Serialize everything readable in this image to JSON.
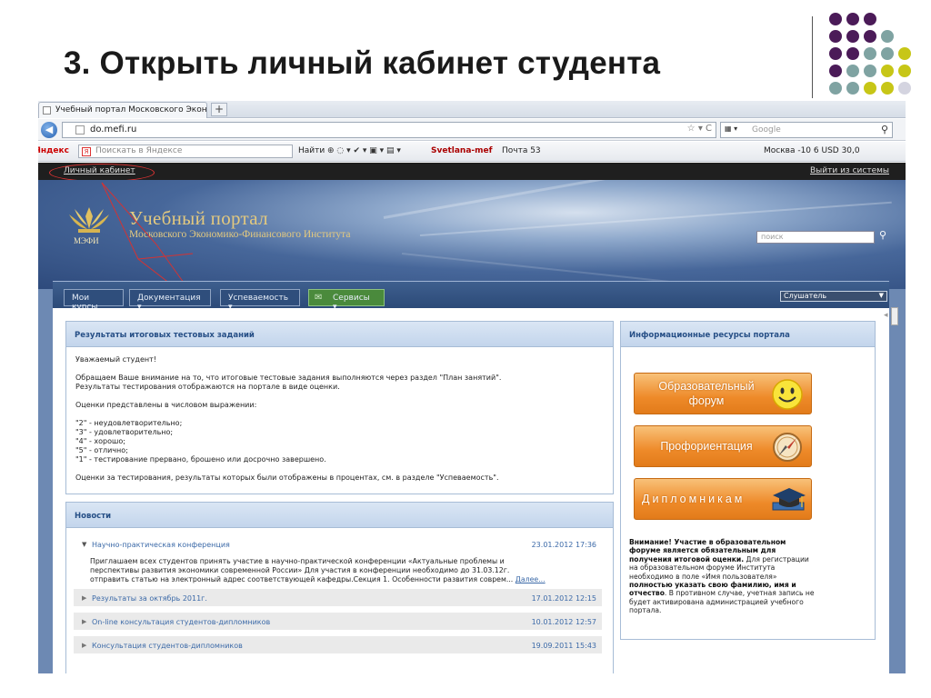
{
  "slide": {
    "title": "3. Открыть личный кабинет студента"
  },
  "browser": {
    "tab_title": "Учебный портал Московского Экон...",
    "new_tab": "+",
    "url": "do.mefi.ru",
    "search_placeholder": "Google",
    "yandex": {
      "logo": "Яндекс",
      "search_placeholder": "Поискать в Яндексе",
      "find_label": "Найти",
      "user": "Svetlana-mef",
      "mail": "Почта 53",
      "weather": "Москва -10 6 USD 30,0"
    }
  },
  "portal": {
    "top_links": {
      "cabinet": "Личный кабинет",
      "logout": "Выйти из системы"
    },
    "header": {
      "logo_abbr": "МЭФИ",
      "title": "Учебный портал",
      "subtitle": "Московского Экономико-Финансового Института",
      "search_placeholder": "поиск"
    },
    "menu": [
      {
        "label": "Мои курсы"
      },
      {
        "label": "Документация ▾"
      },
      {
        "label": "Успеваемость ▾"
      },
      {
        "label": "Сервисы ▾"
      }
    ],
    "role": "Слушатель",
    "results_panel": {
      "title": "Результаты итоговых тестовых заданий",
      "greeting": "Уважаемый студент!",
      "p1_line1": "Обращаем Ваше внимание на то, что итоговые тестовые задания выполняются через раздел \"План занятий\".",
      "p1_line2": "Результаты тестирования отображаются на портале в виде оценки.",
      "p2": "Оценки представлены в числовом выражении:",
      "grades": [
        "\"2\" - неудовлетворительно;",
        "\"3\" - удовлетворительно;",
        "\"4\" - хорошо;",
        "\"5\" - отлично;",
        "\"1\" -  тестирование прервано, брошено или досрочно завершено."
      ],
      "p3": "Оценки за тестирования, результаты которых были отображены в процентах, см. в разделе \"Успеваемость\"."
    },
    "news": {
      "title": "Новости",
      "open_item": {
        "title": "Научно-практическая конференция",
        "date": "23.01.2012 17:36",
        "line1": "Приглашаем всех студентов принять участие в научно-практической конференции «Актуальные проблемы и",
        "line2": "перспективы развития экономики современной России» Для участия в конференции необходимо до 31.03.12г.",
        "line3": "отправить статью на электронный адрес соответствующей кафедры.Секция 1. Особенности развития соврем...",
        "more": "Далее..."
      },
      "items": [
        {
          "title": "Результаты за октябрь 2011г.",
          "date": "17.01.2012 12:15"
        },
        {
          "title": "On-line консультация студентов-дипломников",
          "date": "10.01.2012 12:57"
        },
        {
          "title": "Консультация студентов-дипломников",
          "date": "19.09.2011 15:43"
        }
      ]
    },
    "resources": {
      "title": "Информационные ресурсы портала",
      "buttons": [
        {
          "label": "Образовательный форум",
          "line1": "Образовательный",
          "line2": "форум",
          "icon": "smiley-icon"
        },
        {
          "label": "Профориентация",
          "icon": "compass-icon"
        },
        {
          "label": "Дипломникам",
          "icon": "graduation-cap-icon"
        }
      ],
      "note_bold1": "Внимание! Участие в образовательном форуме является обязательным для получения итоговой оценки.",
      "note_text1": " Для регистрации на образовательном форуме Института необходимо в поле «Имя пользователя» ",
      "note_bold2": "полностью указать свою фамилию, имя и отчество",
      "note_text2": ". В противном случае, учетная запись не будет активирована администрацией учебного портала."
    }
  },
  "colors": {
    "accent_purple": "#4b1b58",
    "accent_teal": "#7fa3a2",
    "accent_olive": "#c7c617",
    "accent_gray": "#d4d4e0",
    "portal_blue": "#264f86",
    "orange": "#ee8a29",
    "annotation_red": "#d33333"
  }
}
